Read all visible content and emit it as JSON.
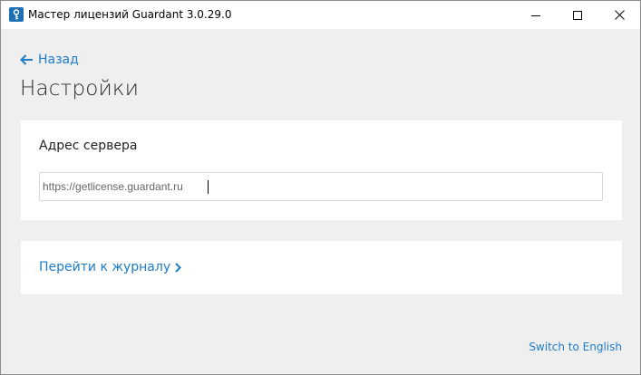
{
  "window": {
    "title": "Мастер лицензий Guardant 3.0.29.0",
    "icon": "key-icon",
    "controls": {
      "minimize_icon": "minimize-icon",
      "maximize_icon": "maximize-icon",
      "close_icon": "close-icon"
    }
  },
  "nav": {
    "back_label": "Назад",
    "back_icon": "arrow-left-icon"
  },
  "page": {
    "title": "Настройки"
  },
  "server": {
    "label": "Адрес сервера",
    "value": "https://getlicense.guardant.ru",
    "placeholder": ""
  },
  "journal": {
    "link_label": "Перейти к журналу",
    "icon": "chevron-right-icon"
  },
  "language": {
    "switch_label": "Switch to English"
  },
  "colors": {
    "accent": "#1e7cc8",
    "background": "#efefef",
    "card": "#ffffff",
    "titlebar": "#ffffff"
  }
}
